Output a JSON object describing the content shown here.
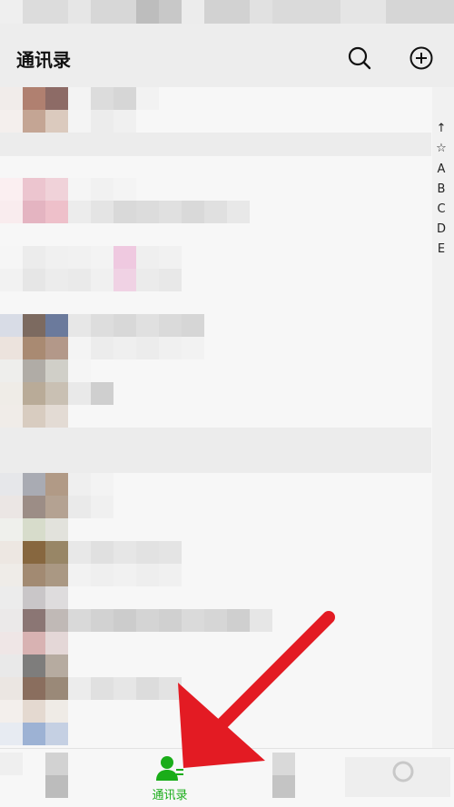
{
  "header": {
    "title": "通讯录"
  },
  "index_bar": {
    "letters": [
      "↑",
      "☆",
      "A",
      "B",
      "C",
      "D",
      "E"
    ]
  },
  "tabbar": {
    "contacts_label": "通讯录"
  },
  "colors": {
    "accent_green": "#1aad19",
    "arrow_red": "#e31b23",
    "header_bg": "#ededed"
  },
  "icons": {
    "search": "search-icon",
    "add": "plus-circle-icon",
    "contacts": "person-icon"
  }
}
